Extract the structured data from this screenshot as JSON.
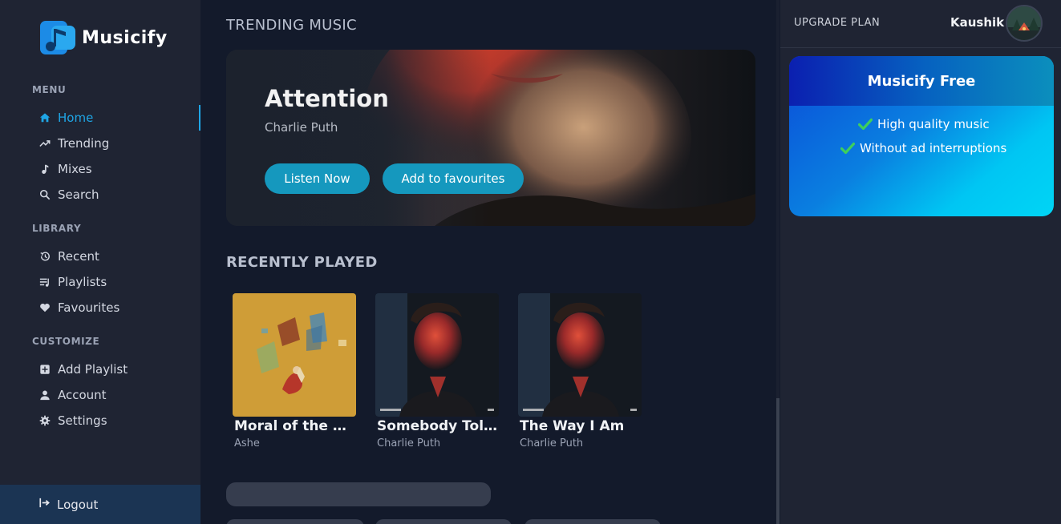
{
  "app": {
    "name": "Musicify"
  },
  "sidebar": {
    "sections": [
      {
        "label": "MENU"
      },
      {
        "label": "LIBRARY"
      },
      {
        "label": "CUSTOMIZE"
      }
    ],
    "menu": [
      {
        "label": "Home",
        "icon": "home-icon",
        "active": true
      },
      {
        "label": "Trending",
        "icon": "trending-icon"
      },
      {
        "label": "Mixes",
        "icon": "music-note-icon"
      },
      {
        "label": "Search",
        "icon": "search-icon"
      }
    ],
    "library": [
      {
        "label": "Recent",
        "icon": "history-icon"
      },
      {
        "label": "Playlists",
        "icon": "playlist-icon"
      },
      {
        "label": "Favourites",
        "icon": "heart-icon"
      }
    ],
    "customize": [
      {
        "label": "Add Playlist",
        "icon": "add-box-icon"
      },
      {
        "label": "Account",
        "icon": "user-icon"
      },
      {
        "label": "Settings",
        "icon": "gear-icon"
      }
    ],
    "logout": {
      "label": "Logout",
      "icon": "logout-icon"
    }
  },
  "main": {
    "trending_heading": "TRENDING MUSIC",
    "hero": {
      "title": "Attention",
      "artist": "Charlie Puth",
      "listen_label": "Listen Now",
      "favourite_label": "Add to favourites"
    },
    "recent_heading": "RECENTLY PLAYED",
    "recent": [
      {
        "title": "Moral of the Sto...",
        "artist": "Ashe"
      },
      {
        "title": "Somebody Told ...",
        "artist": "Charlie Puth"
      },
      {
        "title": "The Way I Am",
        "artist": "Charlie Puth"
      }
    ]
  },
  "right_panel": {
    "upgrade_label": "UPGRADE PLAN",
    "username": "Kaushik",
    "plan": {
      "title": "Musicify Free",
      "features": [
        "High quality music",
        "Without ad interruptions"
      ]
    }
  },
  "colors": {
    "accent": "#1fa6e6",
    "button": "#1598be",
    "check": "#3ecf5c"
  }
}
